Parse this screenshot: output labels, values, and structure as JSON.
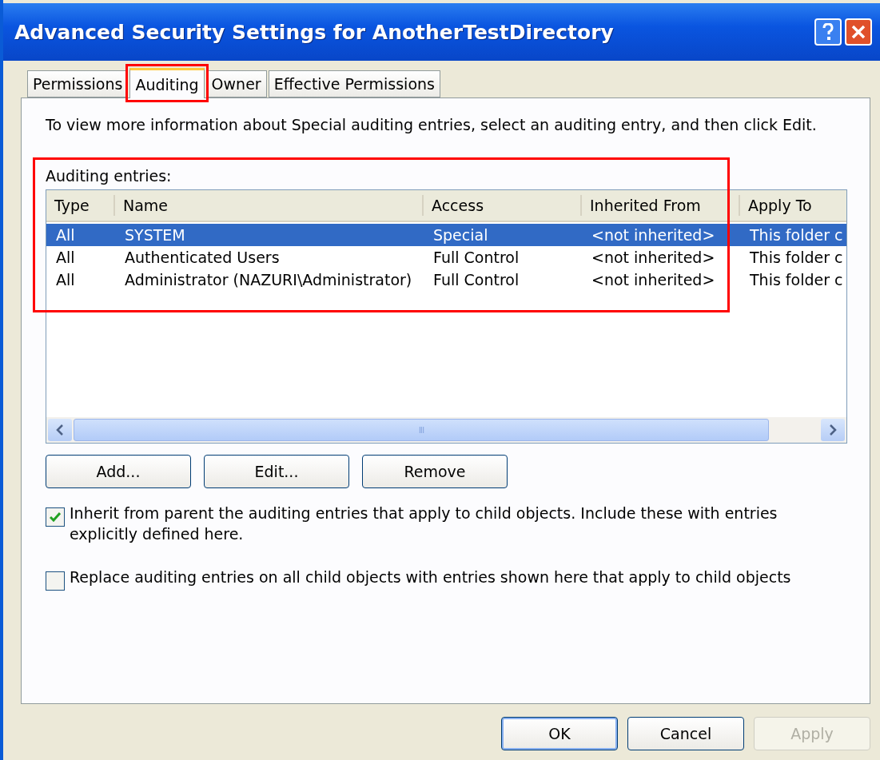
{
  "window": {
    "title": "Advanced Security Settings for AnotherTestDirectory"
  },
  "tabs": [
    {
      "label": "Permissions",
      "selected": false,
      "highlighted": false
    },
    {
      "label": "Auditing",
      "selected": true,
      "highlighted": true
    },
    {
      "label": "Owner",
      "selected": false,
      "highlighted": false
    },
    {
      "label": "Effective Permissions",
      "selected": false,
      "highlighted": false
    }
  ],
  "intro": "To view more information about Special auditing entries, select an auditing entry, and then click Edit.",
  "entries": {
    "label": "Auditing entries:",
    "highlighted": true,
    "columns": [
      "Type",
      "Name",
      "Access",
      "Inherited From",
      "Apply To"
    ],
    "rows": [
      {
        "cells": [
          "All",
          "SYSTEM",
          "Special",
          "<not inherited>",
          "This folder c"
        ],
        "selected": true
      },
      {
        "cells": [
          "All",
          "Authenticated Users",
          "Full Control",
          "<not inherited>",
          "This folder c"
        ],
        "selected": false
      },
      {
        "cells": [
          "All",
          "Administrator (NAZURI\\Administrator)",
          "Full Control",
          "<not inherited>",
          "This folder c"
        ],
        "selected": false
      }
    ],
    "scroll_grip": "III"
  },
  "entry_buttons": [
    {
      "label": "Add...",
      "disabled": false
    },
    {
      "label": "Edit...",
      "disabled": false
    },
    {
      "label": "Remove",
      "disabled": false
    }
  ],
  "options": [
    {
      "label": "Inherit from parent the auditing entries that apply to child objects. Include these with entries explicitly defined here.",
      "checked": true
    },
    {
      "label": "Replace auditing entries on all child objects with entries shown here that apply to child objects",
      "checked": false
    }
  ],
  "dialog_buttons": [
    {
      "label": "OK",
      "disabled": false,
      "default": true
    },
    {
      "label": "Cancel",
      "disabled": false,
      "default": false
    },
    {
      "label": "Apply",
      "disabled": true,
      "default": false
    }
  ]
}
